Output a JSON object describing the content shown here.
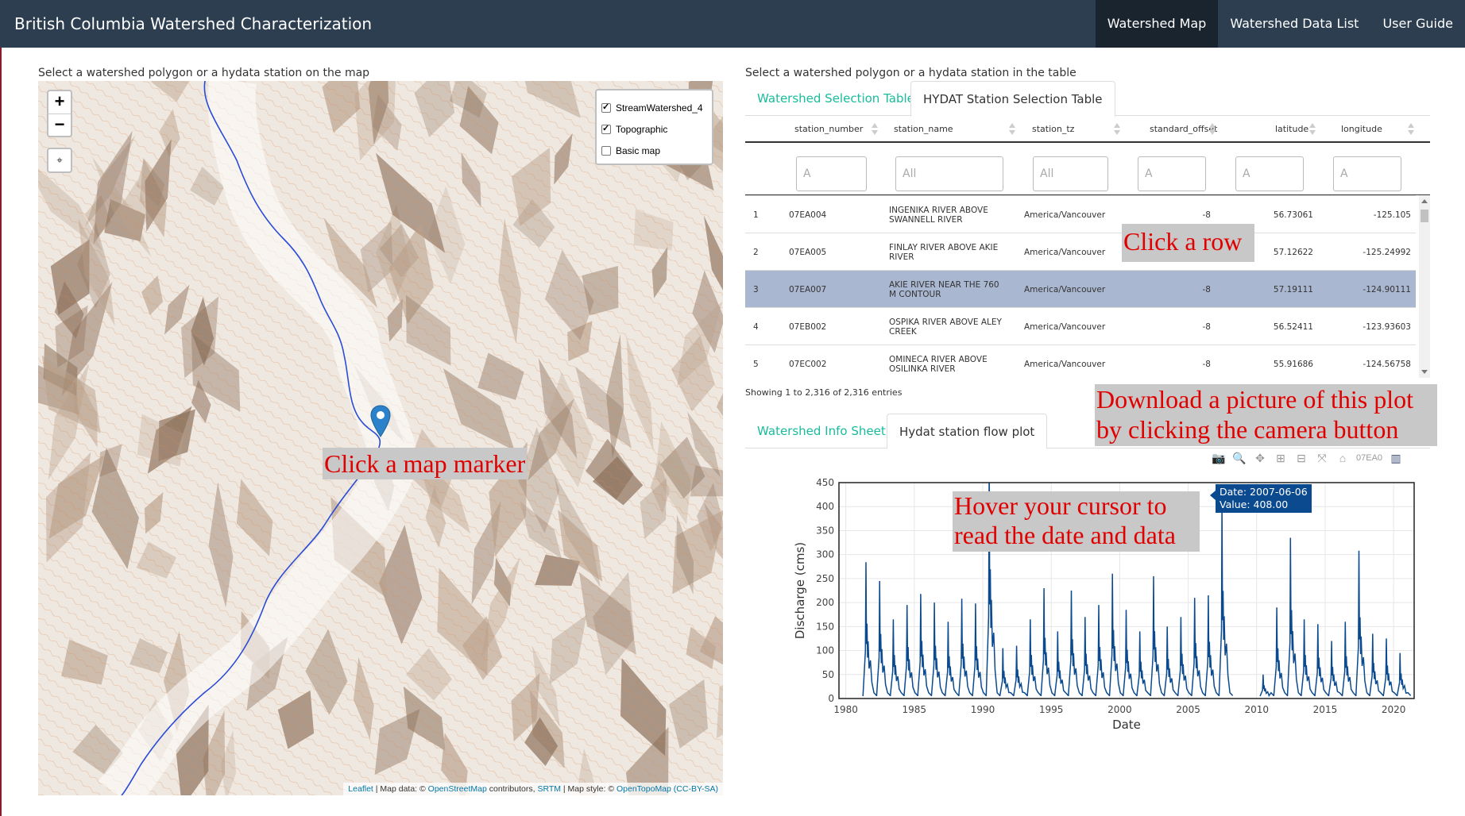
{
  "app": {
    "title": "British Columbia Watershed Characterization",
    "nav": [
      {
        "label": "Watershed Map",
        "active": true
      },
      {
        "label": "Watershed Data List",
        "active": false
      },
      {
        "label": "User Guide",
        "active": false
      }
    ]
  },
  "map_panel": {
    "instruction": "Select a watershed polygon or a hydata station on the map",
    "zoom_in": "+",
    "zoom_out": "−",
    "layers": [
      {
        "label": "StreamWatershed_4",
        "checked": true
      },
      {
        "label": "Topographic",
        "checked": true
      },
      {
        "label": "Basic map",
        "checked": false
      }
    ],
    "attribution": {
      "leaflet": "Leaflet",
      "sep1": " | Map data: © ",
      "osm": "OpenStreetMap",
      "sep2": " contributors, ",
      "srtm": "SRTM",
      "sep3": " | Map style: © ",
      "otm": "OpenTopoMap",
      "license": "(CC-BY-SA)"
    },
    "callout": "Click a map marker"
  },
  "table_panel": {
    "instruction": "Select a watershed polygon or a hydata station in the table",
    "tabs": [
      {
        "label": "Watershed Selection Table",
        "active": false
      },
      {
        "label": "HYDAT Station Selection Table",
        "active": true
      }
    ],
    "columns": [
      "station_number",
      "station_name",
      "station_tz",
      "standard_offset",
      "latitude",
      "longitude"
    ],
    "filters": [
      "A",
      "All",
      "All",
      "A",
      "A",
      "A"
    ],
    "rows": [
      {
        "idx": "1",
        "station_number": "07EA004",
        "station_name": "INGENIKA RIVER ABOVE SWANNELL RIVER",
        "station_tz": "America/Vancouver",
        "standard_offset": "-8",
        "latitude": "56.73061",
        "longitude": "-125.105",
        "selected": false
      },
      {
        "idx": "2",
        "station_number": "07EA005",
        "station_name": "FINLAY RIVER ABOVE AKIE RIVER",
        "station_tz": "America/Vancouver",
        "standard_offset": "-8",
        "latitude": "57.12622",
        "longitude": "-125.24992",
        "selected": false
      },
      {
        "idx": "3",
        "station_number": "07EA007",
        "station_name": "AKIE RIVER NEAR THE 760 M CONTOUR",
        "station_tz": "America/Vancouver",
        "standard_offset": "-8",
        "latitude": "57.19111",
        "longitude": "-124.90111",
        "selected": true
      },
      {
        "idx": "4",
        "station_number": "07EB002",
        "station_name": "OSPIKA RIVER ABOVE ALEY CREEK",
        "station_tz": "America/Vancouver",
        "standard_offset": "-8",
        "latitude": "56.52411",
        "longitude": "-123.93603",
        "selected": false
      },
      {
        "idx": "5",
        "station_number": "07EC002",
        "station_name": "OMINECA RIVER ABOVE OSILINKA RIVER",
        "station_tz": "America/Vancouver",
        "standard_offset": "-8",
        "latitude": "55.91686",
        "longitude": "-124.56758",
        "selected": false
      }
    ],
    "info": "Showing 1 to 2,316 of 2,316 entries",
    "callout": "Click a row"
  },
  "plot_panel": {
    "tabs": [
      {
        "label": "Watershed Info Sheet",
        "active": false
      },
      {
        "label": "Hydat station flow plot",
        "active": true
      }
    ],
    "modebar_legend_text": "07EA0",
    "hover_date": "Date: 2007-06-06",
    "hover_value": "Value: 408.00",
    "callout_download_1": "Download a picture of this plot",
    "callout_download_2": "by clicking the camera button",
    "callout_hover_1": "Hover your cursor to",
    "callout_hover_2": "read the date and data",
    "line_color": "#0b4a8f"
  },
  "chart_data": {
    "type": "line",
    "title": "",
    "xlabel": "Date",
    "ylabel": "Discharge (cms)",
    "xlim": [
      1979.5,
      2021.5
    ],
    "ylim": [
      0,
      450
    ],
    "x_ticks": [
      1980,
      1985,
      1990,
      1995,
      2000,
      2005,
      2010,
      2015,
      2020
    ],
    "y_ticks": [
      0,
      50,
      100,
      150,
      200,
      250,
      300,
      350,
      400,
      450
    ],
    "series": [
      {
        "peaks": [
          {
            "year": 1981,
            "peak": 284
          },
          {
            "year": 1982,
            "peak": 245
          },
          {
            "year": 1983,
            "peak": 165
          },
          {
            "year": 1984,
            "peak": 195
          },
          {
            "year": 1985,
            "peak": 218
          },
          {
            "year": 1986,
            "peak": 200
          },
          {
            "year": 1987,
            "peak": 160
          },
          {
            "year": 1988,
            "peak": 208
          },
          {
            "year": 1989,
            "peak": 198
          },
          {
            "year": 1990,
            "peak": 490
          },
          {
            "year": 1991,
            "peak": 105
          },
          {
            "year": 1992,
            "peak": 110
          },
          {
            "year": 1993,
            "peak": 165
          },
          {
            "year": 1994,
            "peak": 230
          },
          {
            "year": 1995,
            "peak": 140
          },
          {
            "year": 1996,
            "peak": 225
          },
          {
            "year": 1997,
            "peak": 170
          },
          {
            "year": 1998,
            "peak": 195
          },
          {
            "year": 1999,
            "peak": 260
          },
          {
            "year": 2000,
            "peak": 185
          },
          {
            "year": 2001,
            "peak": 140
          },
          {
            "year": 2002,
            "peak": 255
          },
          {
            "year": 2003,
            "peak": 150
          },
          {
            "year": 2004,
            "peak": 170
          },
          {
            "year": 2005,
            "peak": 210
          },
          {
            "year": 2006,
            "peak": 215
          },
          {
            "year": 2007,
            "peak": 408
          },
          {
            "year": 2010,
            "peak": 50
          },
          {
            "year": 2011,
            "peak": 190
          },
          {
            "year": 2012,
            "peak": 335
          },
          {
            "year": 2013,
            "peak": 165
          },
          {
            "year": 2014,
            "peak": 155
          },
          {
            "year": 2015,
            "peak": 120
          },
          {
            "year": 2016,
            "peak": 160
          },
          {
            "year": 2017,
            "peak": 308
          },
          {
            "year": 2018,
            "peak": 135
          },
          {
            "year": 2019,
            "peak": 125
          },
          {
            "year": 2020,
            "peak": 95
          }
        ]
      }
    ],
    "grid": true
  }
}
